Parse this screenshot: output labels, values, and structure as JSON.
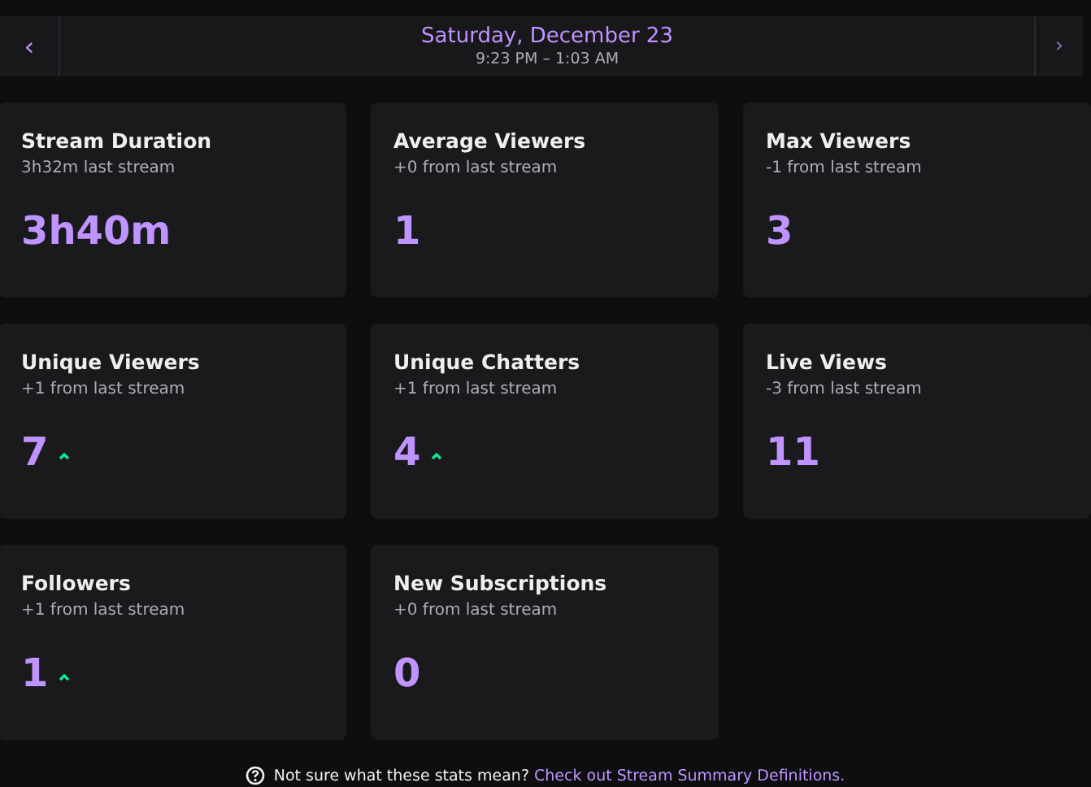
{
  "header": {
    "date": "Saturday, December 23",
    "time_range": "9:23 PM – 1:03 AM",
    "prev_icon": "‹",
    "next_icon": "›"
  },
  "cards": [
    {
      "title": "Stream Duration",
      "comparison": "3h32m last stream",
      "value": "3h40m",
      "trend_up": false
    },
    {
      "title": "Average Viewers",
      "comparison": "+0 from last stream",
      "value": "1",
      "trend_up": false
    },
    {
      "title": "Max Viewers",
      "comparison": "-1 from last stream",
      "value": "3",
      "trend_up": false
    },
    {
      "title": "Unique Viewers",
      "comparison": "+1 from last stream",
      "value": "7",
      "trend_up": true
    },
    {
      "title": "Unique Chatters",
      "comparison": "+1 from last stream",
      "value": "4",
      "trend_up": true
    },
    {
      "title": "Live Views",
      "comparison": "-3 from last stream",
      "value": "11",
      "trend_up": false
    },
    {
      "title": "Followers",
      "comparison": "+1 from last stream",
      "value": "1",
      "trend_up": true
    },
    {
      "title": "New Subscriptions",
      "comparison": "+0 from last stream",
      "value": "0",
      "trend_up": false
    }
  ],
  "footer": {
    "text": "Not sure what these stats mean?",
    "link": "Check out Stream Summary Definitions."
  }
}
